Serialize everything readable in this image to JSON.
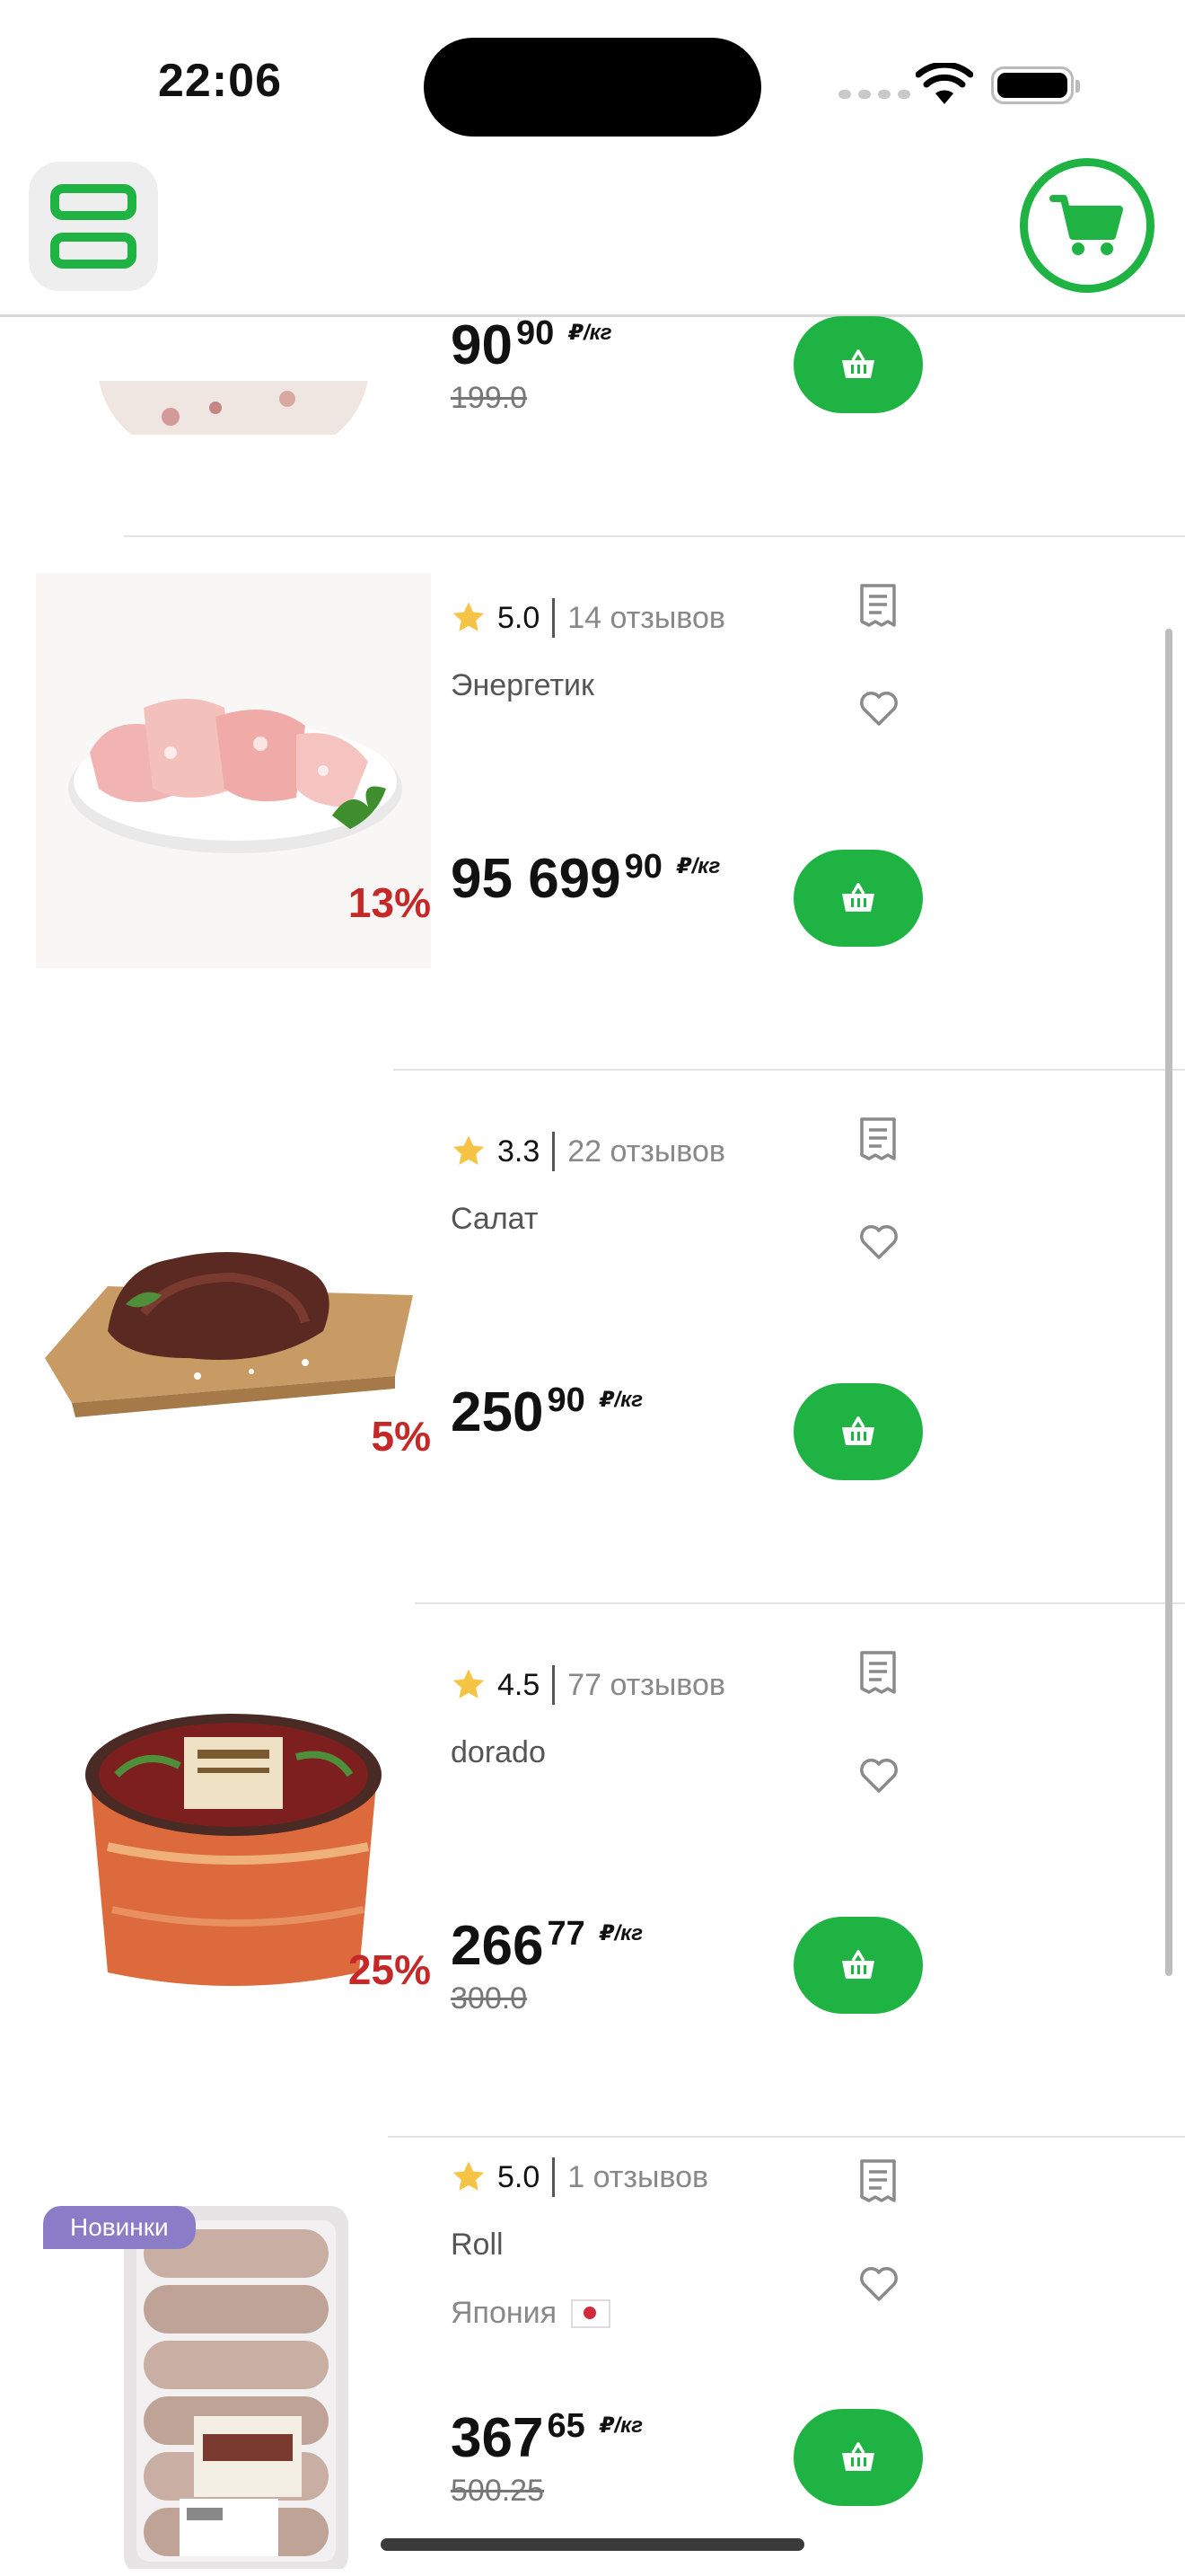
{
  "status_bar": {
    "time": "22:06"
  },
  "colors": {
    "accent": "#1fb344",
    "discount": "#c62828",
    "badge": "#8a7cc6"
  },
  "header": {
    "menu_icon": "app-logo-icon",
    "cart_icon": "cart-icon"
  },
  "products": [
    {
      "price_int": "90",
      "price_frac": "90",
      "unit": "₽/кг",
      "old_price": "199.0"
    },
    {
      "rating": "5.0",
      "reviews": "14 отзывов",
      "name": "Энергетик",
      "discount": "13%",
      "price_int": "95 699",
      "price_frac": "90",
      "unit": "₽/кг"
    },
    {
      "rating": "3.3",
      "reviews": "22 отзывов",
      "name": "Салат",
      "discount": "5%",
      "price_int": "250",
      "price_frac": "90",
      "unit": "₽/кг"
    },
    {
      "rating": "4.5",
      "reviews": "77 отзывов",
      "name": "dorado",
      "discount": "25%",
      "price_int": "266",
      "price_frac": "77",
      "unit": "₽/кг",
      "old_price": "300.0"
    },
    {
      "badge": "Новинки",
      "rating": "5.0",
      "reviews": "1 отзывов",
      "name": "Roll",
      "country": "Япония",
      "price_int": "367",
      "price_frac": "65",
      "unit": "₽/кг",
      "old_price": "500.25"
    }
  ]
}
